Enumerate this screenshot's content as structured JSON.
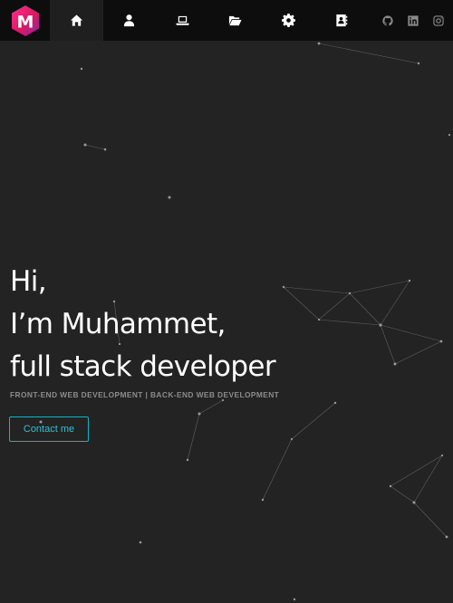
{
  "logo": {
    "letter": "M",
    "colors": [
      "#ff2d8f",
      "#d81b60",
      "#8e24aa"
    ]
  },
  "nav": {
    "items": [
      {
        "icon": "home-icon",
        "active": true
      },
      {
        "icon": "user-icon",
        "active": false
      },
      {
        "icon": "laptop-icon",
        "active": false
      },
      {
        "icon": "folder-open-icon",
        "active": false
      },
      {
        "icon": "gear-icon",
        "active": false
      },
      {
        "icon": "address-book-icon",
        "active": false
      }
    ],
    "social": [
      "github-icon",
      "linkedin-icon",
      "instagram-icon"
    ]
  },
  "hero": {
    "line1": "Hi,",
    "line2": "I’m Muhammet,",
    "line3": "full stack developer",
    "subtitle": "FRONT-END WEB DEVELOPMENT | BACK-END WEB DEVELOPMENT",
    "contact_label": "Contact me"
  },
  "colors": {
    "background": "#232323",
    "navbar": "#0d0d0d",
    "accent": "#15b3c2",
    "subtitle": "#8c8c8c"
  }
}
